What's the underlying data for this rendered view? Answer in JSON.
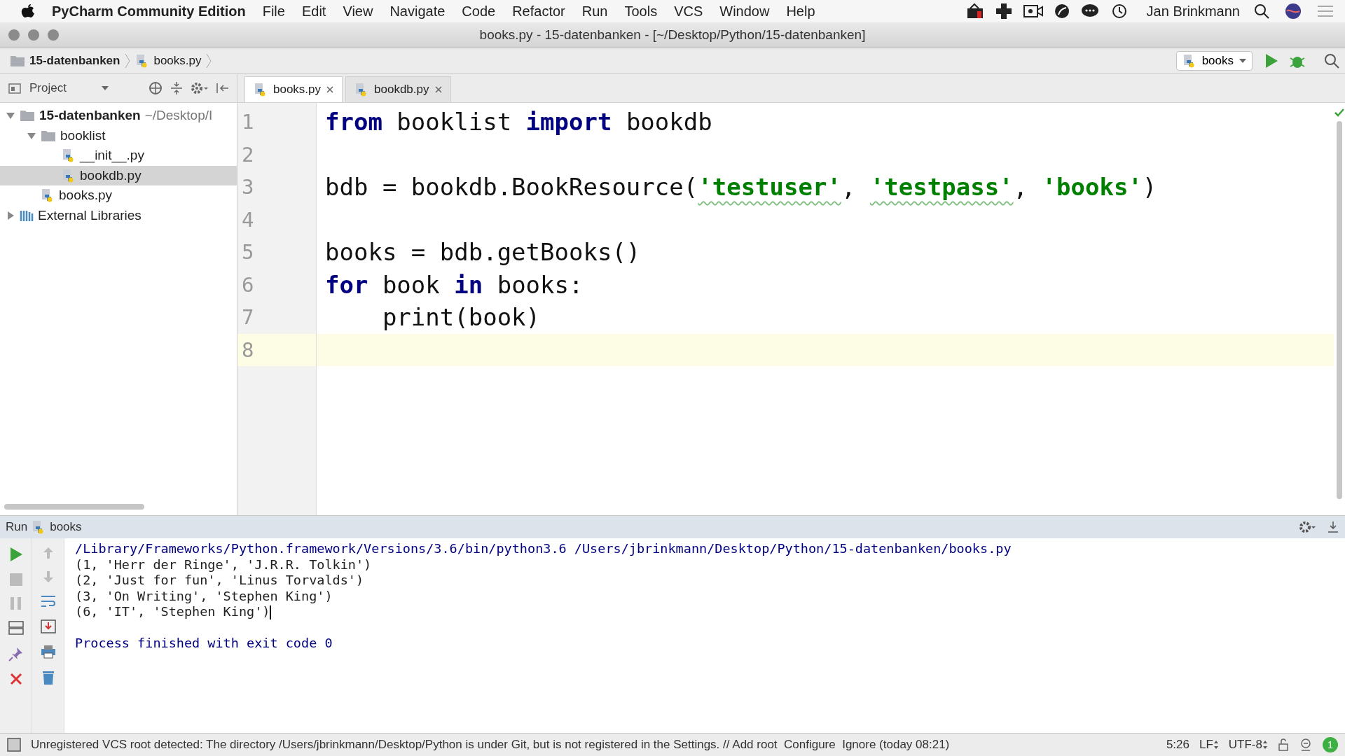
{
  "menu_bar": {
    "app_name": "PyCharm Community Edition",
    "items": [
      "File",
      "Edit",
      "View",
      "Navigate",
      "Code",
      "Refactor",
      "Run",
      "Tools",
      "VCS",
      "Window",
      "Help"
    ],
    "user": "Jan Brinkmann"
  },
  "window": {
    "title": "books.py - 15-datenbanken - [~/Desktop/Python/15-datenbanken]"
  },
  "breadcrumbs": [
    {
      "label": "15-datenbanken",
      "kind": "folder"
    },
    {
      "label": "books.py",
      "kind": "file"
    }
  ],
  "run_config": {
    "label": "books"
  },
  "project_panel": {
    "title": "Project",
    "tree": [
      {
        "label": "15-datenbanken",
        "detail": "~/Desktop/I",
        "kind": "folder",
        "expanded": true,
        "selected": false,
        "children": [
          {
            "label": "booklist",
            "kind": "package",
            "expanded": true,
            "selected": false,
            "children": [
              {
                "label": "__init__.py",
                "kind": "file",
                "selected": false
              },
              {
                "label": "bookdb.py",
                "kind": "file",
                "selected": true
              }
            ]
          },
          {
            "label": "books.py",
            "kind": "file",
            "selected": false
          }
        ]
      },
      {
        "label": "External Libraries",
        "kind": "library",
        "expanded": false,
        "selected": false
      }
    ]
  },
  "editor_tabs": [
    {
      "label": "books.py",
      "selected": true
    },
    {
      "label": "bookdb.py",
      "selected": false
    }
  ],
  "editor": {
    "lines": [
      {
        "number": "1",
        "current": false,
        "tokens": [
          {
            "kind": "keyword",
            "text": "from"
          },
          {
            "kind": "plain",
            "text": " booklist "
          },
          {
            "kind": "keyword",
            "text": "import"
          },
          {
            "kind": "plain",
            "text": " bookdb"
          }
        ]
      },
      {
        "number": "2",
        "current": false
      },
      {
        "number": "3",
        "current": false,
        "tokens": [
          {
            "kind": "plain",
            "text": "bdb = bookdb.BookResource("
          },
          {
            "kind": "string",
            "text": "'testuser'",
            "flagged": true
          },
          {
            "kind": "plain",
            "text": ", "
          },
          {
            "kind": "string",
            "text": "'testpass'",
            "flagged": true
          },
          {
            "kind": "plain",
            "text": ", "
          },
          {
            "kind": "string",
            "text": "'books'",
            "flagged": false
          },
          {
            "kind": "plain",
            "text": ")"
          }
        ]
      },
      {
        "number": "4",
        "current": false
      },
      {
        "number": "5",
        "current": false,
        "tokens": [
          {
            "kind": "plain",
            "text": "books = bdb.getBooks()"
          }
        ]
      },
      {
        "number": "6",
        "current": false,
        "tokens": [
          {
            "kind": "keyword",
            "text": "for"
          },
          {
            "kind": "plain",
            "text": " book "
          },
          {
            "kind": "keyword",
            "text": "in"
          },
          {
            "kind": "plain",
            "text": " books:"
          }
        ]
      },
      {
        "number": "7",
        "current": false,
        "tokens": [
          {
            "kind": "plain",
            "text": "    print(book)"
          }
        ]
      },
      {
        "number": "8",
        "current": true
      }
    ]
  },
  "run_panel": {
    "title": "Run",
    "config": "books",
    "output": [
      {
        "kind": "command",
        "text": "/Library/Frameworks/Python.framework/Versions/3.6/bin/python3.6 /Users/jbrinkmann/Desktop/Python/15-datenbanken/books.py"
      },
      {
        "kind": "output",
        "text": "(1, 'Herr der Ringe', 'J.R.R. Tolkin')"
      },
      {
        "kind": "output",
        "text": "(2, 'Just for fun', 'Linus Torvalds')"
      },
      {
        "kind": "output",
        "text": "(3, 'On Writing', 'Stephen King')"
      },
      {
        "kind": "output",
        "text": "(6, 'IT', 'Stephen King')",
        "caret": true
      },
      {
        "kind": "blank"
      },
      {
        "kind": "status",
        "text": "Process finished with exit code 0"
      }
    ]
  },
  "status_bar": {
    "message": "Unregistered VCS root detected: The directory /Users/jbrinkmann/Desktop/Python is under Git, but is not registered in the Settings. // Add root  Configure  Ignore (today 08:21)",
    "position": "5:26",
    "line_separator": "LF",
    "encoding": "UTF-8",
    "notifications": "1"
  }
}
